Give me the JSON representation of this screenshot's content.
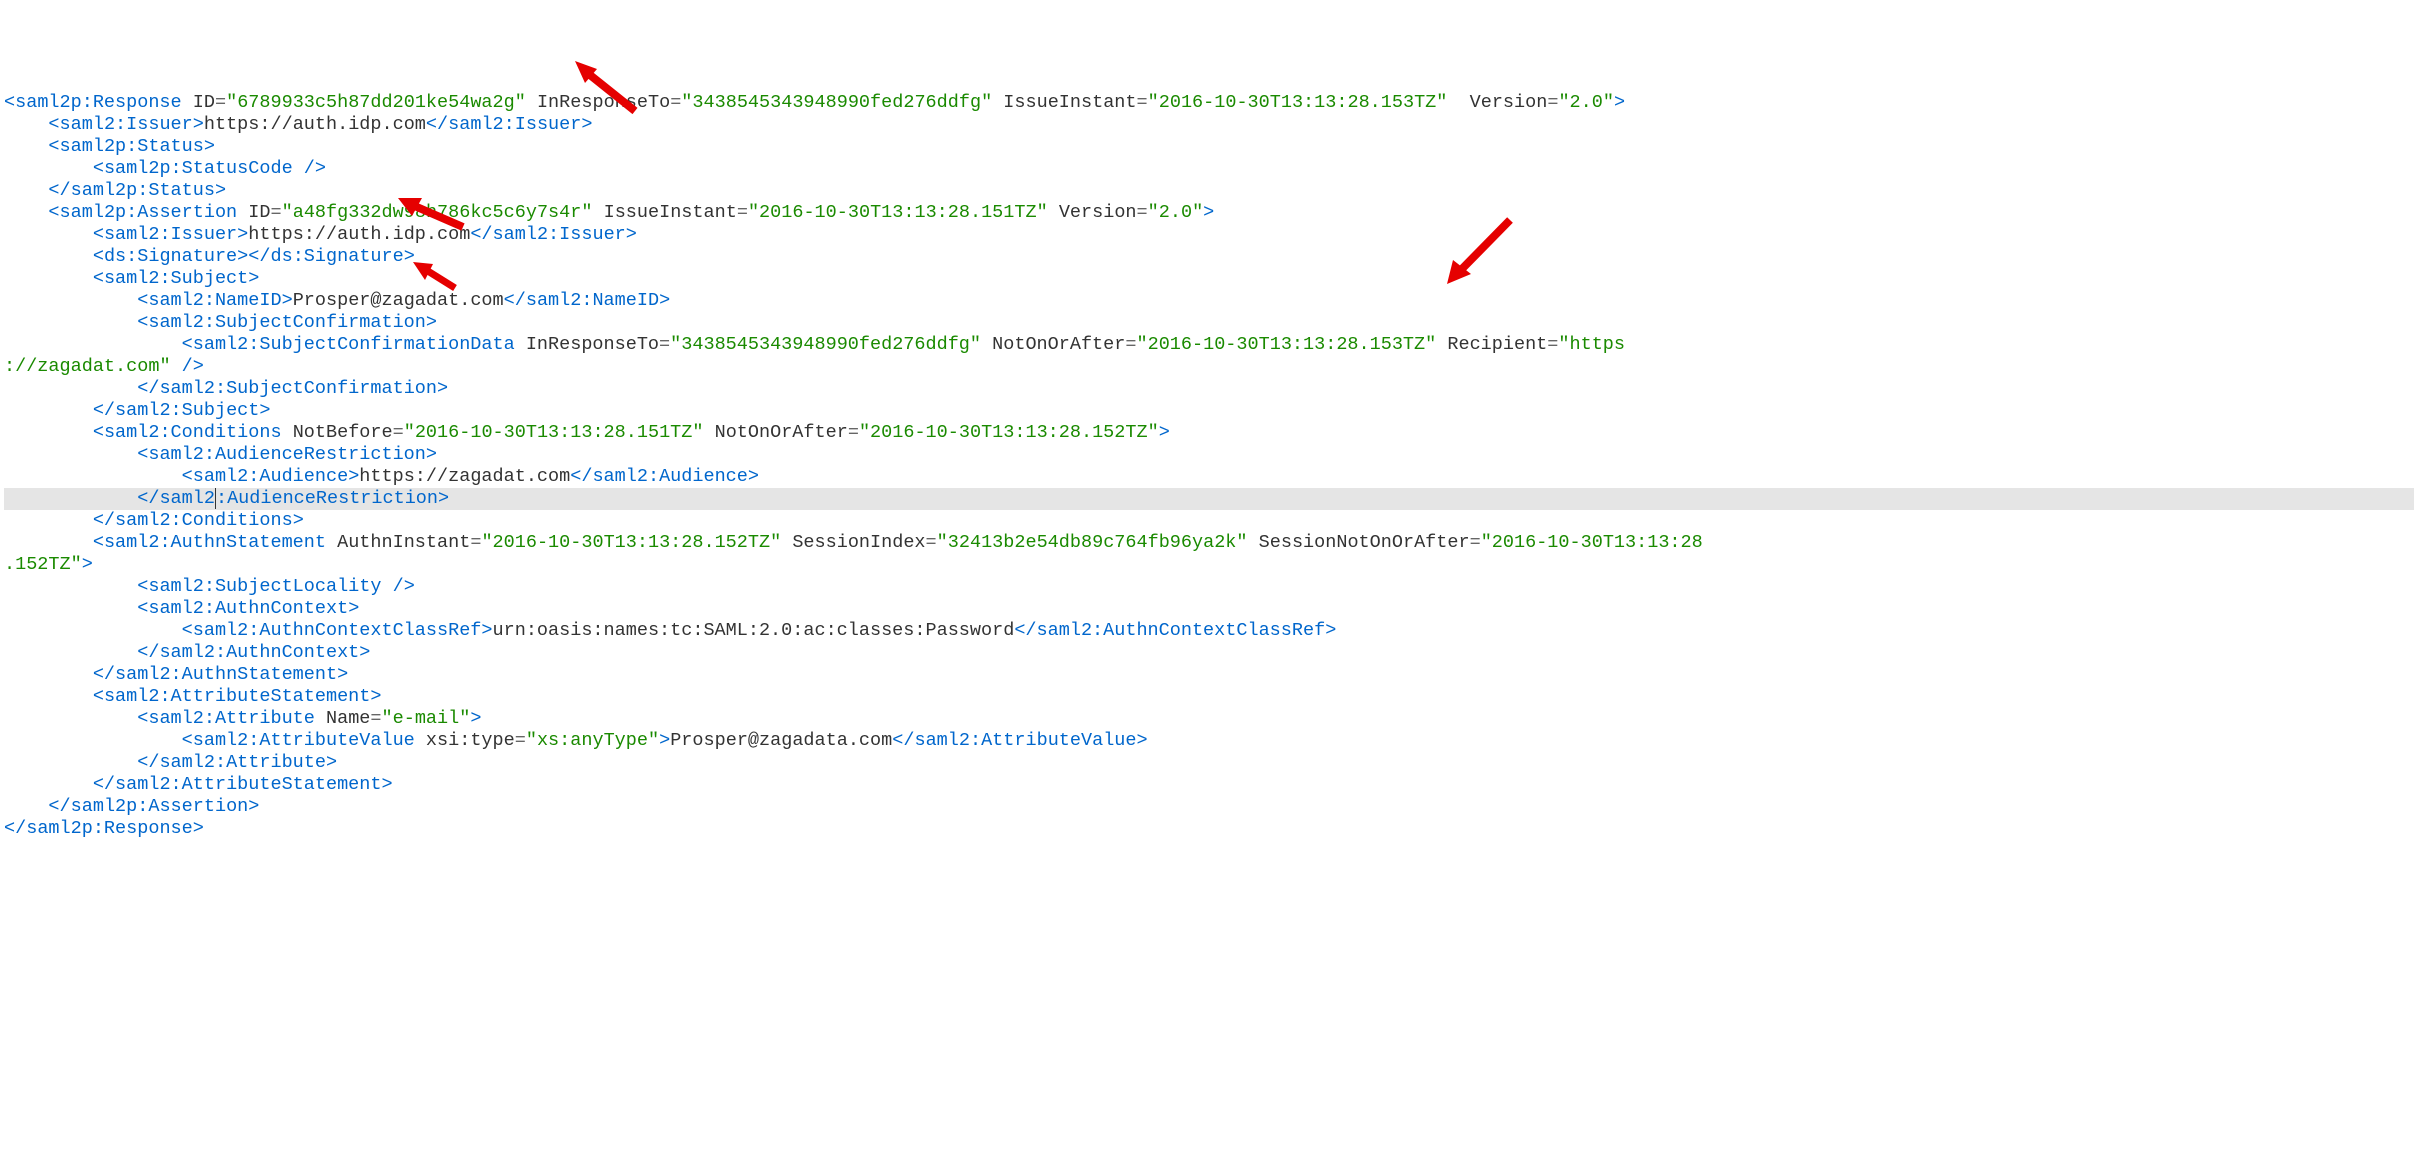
{
  "response": {
    "tag": "saml2p:Response",
    "id": "6789933c5h87dd201ke54wa2g",
    "inResponseTo": "3438545343948990fed276ddfg",
    "issueInstant": "2016-10-30T13:13:28.153TZ",
    "version": "2.0"
  },
  "issuer1": {
    "open": "saml2:Issuer",
    "value": "https://auth.idp.com",
    "close": "saml2:Issuer"
  },
  "status": {
    "open": "saml2p:Status",
    "code": "saml2p:StatusCode",
    "close": "saml2p:Status"
  },
  "assertion": {
    "tag": "saml2p:Assertion",
    "id": "a48fg332dw98h786kc5c6y7s4r",
    "issueInstant": "2016-10-30T13:13:28.151TZ",
    "version": "2.0"
  },
  "issuer2": {
    "open": "saml2:Issuer",
    "value": "https://auth.idp.com",
    "close": "saml2:Issuer"
  },
  "signature": {
    "open": "ds:Signature",
    "close": "ds:Signature"
  },
  "subject": {
    "open": "saml2:Subject",
    "close": "saml2:Subject"
  },
  "nameid": {
    "open": "saml2:NameID",
    "value": "Prosper@zagadat.com",
    "close": "saml2:NameID"
  },
  "subjectConfirmation": {
    "open": "saml2:SubjectConfirmation",
    "close": "saml2:SubjectConfirmation"
  },
  "subjectConfirmationData": {
    "tag": "saml2:SubjectConfirmationData",
    "inResponseTo": "3438545343948990fed276ddfg",
    "notOnOrAfter": "2016-10-30T13:13:28.153TZ",
    "recipient_part1": "https",
    "recipient_part2": "://zagadat.com"
  },
  "conditions": {
    "tag": "saml2:Conditions",
    "notBefore": "2016-10-30T13:13:28.151TZ",
    "notOnOrAfter": "2016-10-30T13:13:28.152TZ",
    "close": "saml2:Conditions"
  },
  "audienceRestriction": {
    "open": "saml2:AudienceRestriction",
    "close_part1": "saml2",
    "close_part2": ":AudienceRestriction"
  },
  "audience": {
    "open": "saml2:Audience",
    "value": "https://zagadat.com",
    "close": "saml2:Audience"
  },
  "authnStatement": {
    "tag": "saml2:AuthnStatement",
    "authnInstant": "2016-10-30T13:13:28.152TZ",
    "sessionIndex": "32413b2e54db89c764fb96ya2k",
    "sessionNotOnOrAfter_part1": "2016-10-30T13:13:28",
    "sessionNotOnOrAfter_part2": ".152TZ",
    "close": "saml2:AuthnStatement"
  },
  "subjectLocality": {
    "tag": "saml2:SubjectLocality"
  },
  "authnContext": {
    "open": "saml2:AuthnContext",
    "close": "saml2:AuthnContext"
  },
  "authnContextClassRef": {
    "open": "saml2:AuthnContextClassRef",
    "value": "urn:oasis:names:tc:SAML:2.0:ac:classes:Password",
    "close": "saml2:AuthnContextClassRef"
  },
  "attributeStatement": {
    "open": "saml2:AttributeStatement",
    "close": "saml2:AttributeStatement"
  },
  "attribute": {
    "tag": "saml2:Attribute",
    "name": "e-mail",
    "close": "saml2:Attribute"
  },
  "attributeValue": {
    "open": "saml2:AttributeValue",
    "xsiType": "xs:anyType",
    "value": "Prosper@zagadata.com",
    "close": "saml2:AttributeValue"
  },
  "assertionClose": "saml2p:Assertion",
  "responseClose": "saml2p:Response",
  "attrLabels": {
    "ID": "ID",
    "InResponseTo": "InResponseTo",
    "IssueInstant": "IssueInstant",
    "Version": "Version",
    "NotOnOrAfter": "NotOnOrAfter",
    "Recipient": "Recipient",
    "NotBefore": "NotBefore",
    "AuthnInstant": "AuthnInstant",
    "SessionIndex": "SessionIndex",
    "SessionNotOnOrAfter": "SessionNotOnOrAfter",
    "Name": "Name",
    "xsiType": "xsi:type"
  }
}
